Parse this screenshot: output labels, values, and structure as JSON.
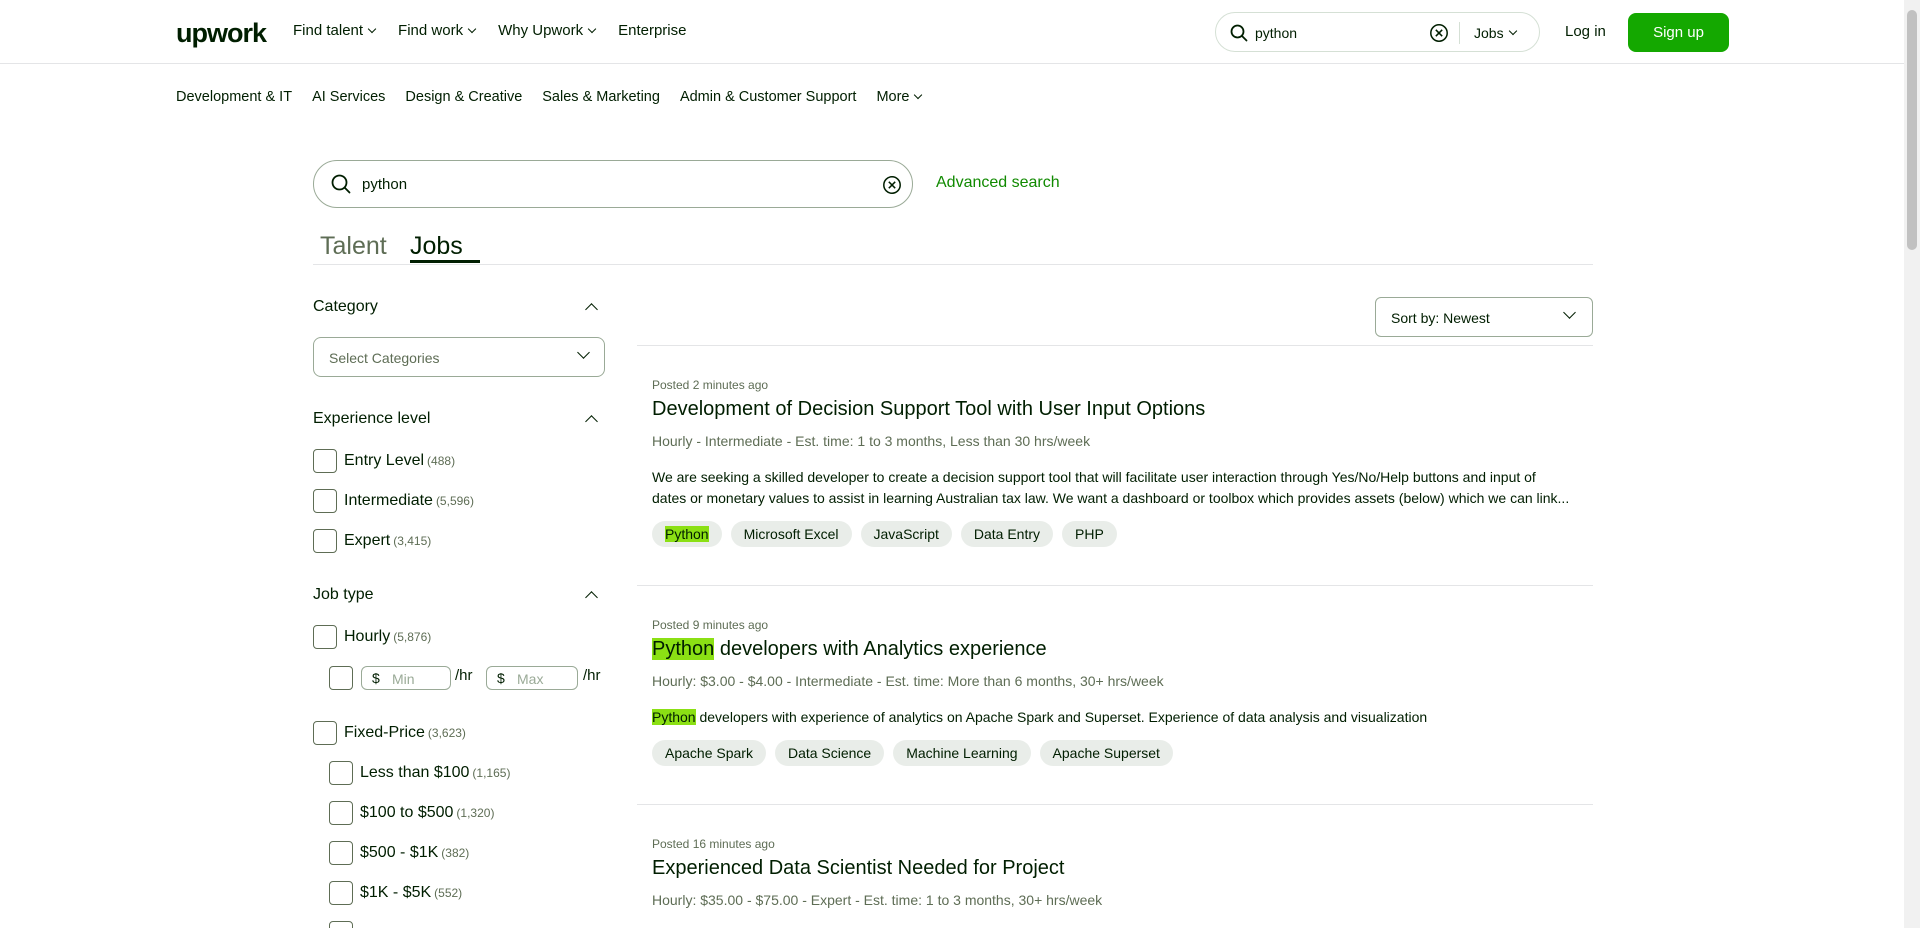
{
  "nav": {
    "logo": "upwork",
    "menu": [
      "Find talent",
      "Find work",
      "Why Upwork",
      "Enterprise"
    ],
    "search_value": "python",
    "search_scope": "Jobs",
    "login": "Log in",
    "signup": "Sign up"
  },
  "categories": [
    "Development & IT",
    "AI Services",
    "Design & Creative",
    "Sales & Marketing",
    "Admin & Customer Support",
    "More"
  ],
  "search": {
    "value": "python",
    "advanced": "Advanced search"
  },
  "tabs": {
    "talent": "Talent",
    "jobs": "Jobs"
  },
  "filters": {
    "category": {
      "title": "Category",
      "placeholder": "Select Categories"
    },
    "experience": {
      "title": "Experience level",
      "options": [
        {
          "label": "Entry Level",
          "count": "(488)"
        },
        {
          "label": "Intermediate",
          "count": "(5,596)"
        },
        {
          "label": "Expert",
          "count": "(3,415)"
        }
      ]
    },
    "jobtype": {
      "title": "Job type",
      "hourly": {
        "label": "Hourly",
        "count": "(5,876)"
      },
      "min_placeholder": "Min",
      "max_placeholder": "Max",
      "currency": "$",
      "per_hr": "/hr",
      "fixed": {
        "label": "Fixed-Price",
        "count": "(3,623)"
      },
      "ranges": [
        {
          "label": "Less than $100",
          "count": "(1,165)"
        },
        {
          "label": "$100 to $500",
          "count": "(1,320)"
        },
        {
          "label": "$500 - $1K",
          "count": "(382)"
        },
        {
          "label": "$1K - $5K",
          "count": "(552)"
        }
      ]
    }
  },
  "sort": {
    "label": "Sort by: Newest"
  },
  "jobs": [
    {
      "posted": "Posted 2 minutes ago",
      "title": "Development of Decision Support Tool with User Input Options",
      "meta": "Hourly - Intermediate - Est. time: 1 to 3 months, Less than 30 hrs/week",
      "description": "We are seeking a skilled developer to create a decision support tool that will facilitate user interaction through Yes/No/Help buttons and input of dates or monetary values to assist in learning Australian tax law. We want a dashboard or toolbox which provides assets (below) which we can link...",
      "skills": [
        "Python",
        "Microsoft Excel",
        "JavaScript",
        "Data Entry",
        "PHP"
      ]
    },
    {
      "posted": "Posted 9 minutes ago",
      "title_hl": "Python",
      "title_rest": " developers with Analytics experience",
      "meta": "Hourly: $3.00 - $4.00 - Intermediate - Est. time: More than 6 months, 30+ hrs/week",
      "desc_hl": "Python",
      "desc_rest": " developers with experience of analytics on Apache Spark and Superset. Experience of data analysis and visualization",
      "skills": [
        "Apache Spark",
        "Data Science",
        "Machine Learning",
        "Apache Superset"
      ]
    },
    {
      "posted": "Posted 16 minutes ago",
      "title": "Experienced Data Scientist Needed for Project",
      "meta": "Hourly: $35.00 - $75.00 - Expert - Est. time: 1 to 3 months, 30+ hrs/week"
    }
  ]
}
